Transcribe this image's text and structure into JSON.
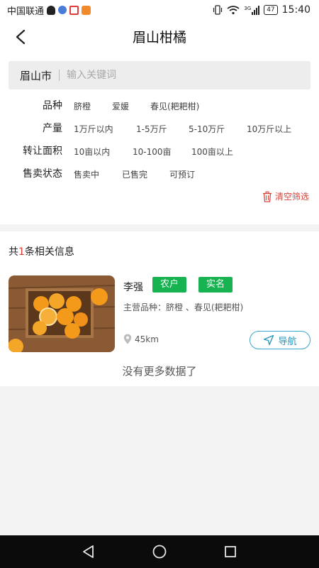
{
  "status_bar": {
    "carrier": "中国联通",
    "battery": "47",
    "time": "15:40",
    "signal_label": "3G"
  },
  "header": {
    "title": "眉山柑橘"
  },
  "search": {
    "city": "眉山市",
    "placeholder": "输入关键词"
  },
  "filters": [
    {
      "label": "品种",
      "options": [
        "脐橙",
        "爱媛",
        "春见(耙耙柑)"
      ]
    },
    {
      "label": "产量",
      "options": [
        "1万斤以内",
        "1-5万斤",
        "5-10万斤",
        "10万斤以上"
      ]
    },
    {
      "label": "转让面积",
      "options": [
        "10亩以内",
        "10-100亩",
        "100亩以上"
      ]
    },
    {
      "label": "售卖状态",
      "options": [
        "售卖中",
        "已售完",
        "可预订"
      ]
    }
  ],
  "clear_filters_label": "清空筛选",
  "results": {
    "prefix": "共",
    "count": "1",
    "suffix": "条相关信息",
    "items": [
      {
        "name": "李强",
        "tags": [
          "农户",
          "实名"
        ],
        "varieties": "主营品种：脐橙 、春见(耙耙柑)",
        "distance": "45km",
        "nav_label": "导航"
      }
    ],
    "no_more": "没有更多数据了"
  },
  "colors": {
    "accent_green": "#16b350",
    "accent_red": "#e23b2f",
    "nav_blue": "#2a95bd"
  }
}
